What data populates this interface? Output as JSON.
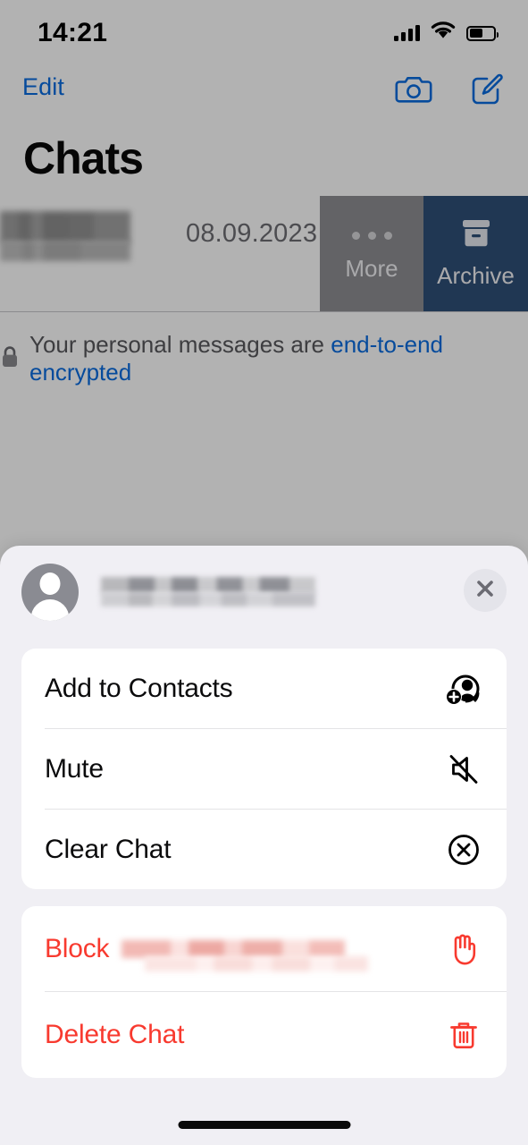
{
  "status_bar": {
    "time": "14:21",
    "signal_icon": "cellular-signal-icon",
    "wifi_icon": "wifi-icon",
    "battery_icon": "battery-icon"
  },
  "nav": {
    "edit_label": "Edit",
    "camera_icon": "camera-icon",
    "compose_icon": "compose-icon",
    "accent_color": "#0a6ce0"
  },
  "header": {
    "title": "Chats"
  },
  "chat_list": {
    "row": {
      "name_redacted": "",
      "date": "08.09.2023",
      "swipe_actions": [
        {
          "label": "More",
          "icon": "ellipsis-icon",
          "color": "#8e8e93"
        },
        {
          "label": "Archive",
          "icon": "archive-box-icon",
          "color": "#2f4f78"
        }
      ]
    }
  },
  "encryption_notice": {
    "icon": "lock-icon",
    "text": "Your personal messages are ",
    "link_text": "end-to-end encrypted",
    "link_color": "#0a6ce0"
  },
  "action_sheet": {
    "contact": {
      "avatar_icon": "person-avatar-icon",
      "name_redacted": ""
    },
    "close_icon": "close-icon",
    "primary_items": [
      {
        "label": "Add to Contacts",
        "icon": "person-add-icon"
      },
      {
        "label": "Mute",
        "icon": "speaker-mute-icon"
      },
      {
        "label": "Clear Chat",
        "icon": "x-circle-icon"
      }
    ],
    "destructive_items": [
      {
        "label": "Block",
        "name_redacted": "",
        "icon": "raised-hand-icon"
      },
      {
        "label": "Delete Chat",
        "icon": "trash-icon"
      }
    ],
    "destructive_color": "#f83a2f"
  },
  "home_indicator": "home-indicator"
}
